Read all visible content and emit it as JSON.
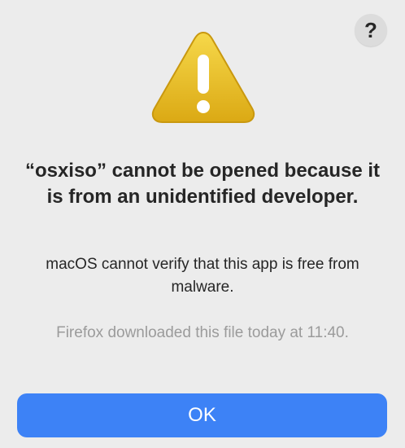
{
  "dialog": {
    "help_label": "?",
    "title": "“osxiso” cannot be opened because it is from an unidentified developer.",
    "message": "macOS cannot verify that this app is free from malware.",
    "detail": "Firefox downloaded this file today at 11:40.",
    "ok_label": "OK",
    "icon": "warning-triangle-icon"
  },
  "colors": {
    "background": "#ececec",
    "accent": "#3d82f6",
    "warning": "#e8bb20",
    "text": "#262626",
    "secondary_text": "#9b9b9b"
  }
}
